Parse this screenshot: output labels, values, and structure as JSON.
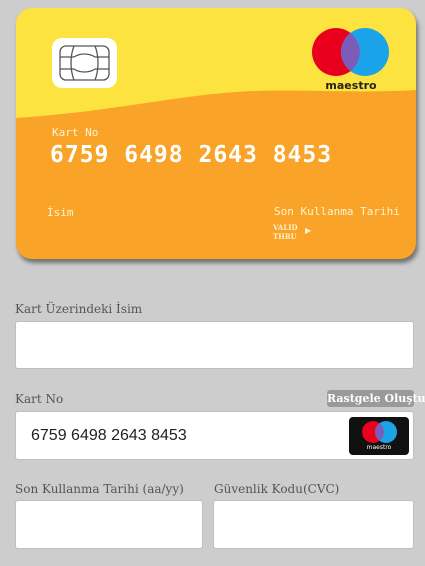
{
  "card": {
    "brand_name": "maestro",
    "card_number_label": "Kart No",
    "card_number": "6759 6498 2643 8453",
    "name_label": "İsim",
    "expiry_label": "Son Kullanma Tarihi",
    "valid_thru_line1": "VALID",
    "valid_thru_line2": "THRU",
    "valid_arrow": "▶",
    "colors": {
      "yellow": "#fde33f",
      "orange": "#f9a428",
      "mc_red": "#e8001c",
      "mc_blue": "#1aa3e8"
    }
  },
  "form": {
    "name_label": "Kart Üzerindeki İsim",
    "name_value": "",
    "card_number_label": "Kart No",
    "random_button_label": "Rastgele Oluştur",
    "card_number_value": "6759 6498 2643 8453",
    "brand_logo_text": "maestro",
    "expiry_label": "Son Kullanma Tarihi (aa/yy)",
    "expiry_value": "",
    "cvc_label": "Güvenlik Kodu(CVC)",
    "cvc_value": ""
  }
}
